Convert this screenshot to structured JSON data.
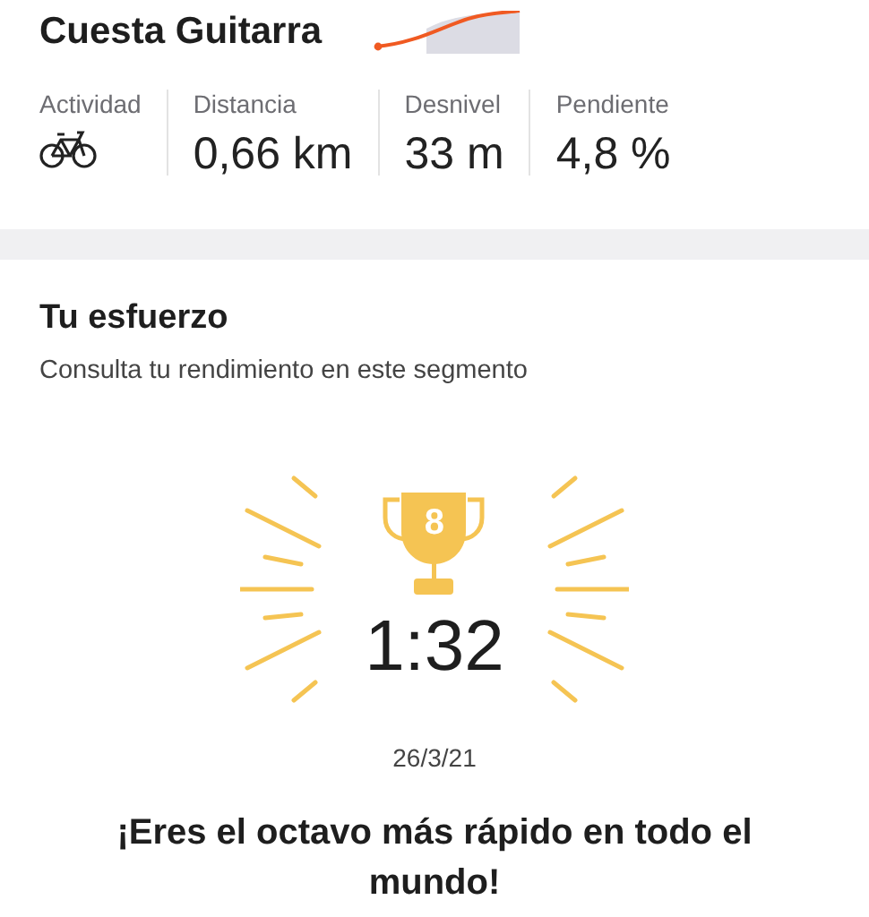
{
  "segment": {
    "title": "Cuesta Guitarra"
  },
  "stats": [
    {
      "kind": "icon",
      "label": "Actividad"
    },
    {
      "kind": "value",
      "label": "Distancia",
      "value": "0,66 km"
    },
    {
      "kind": "value",
      "label": "Desnivel",
      "value": "33 m"
    },
    {
      "kind": "value",
      "label": "Pendiente",
      "value": "4,8 %"
    }
  ],
  "effort": {
    "title": "Tu esfuerzo",
    "subtitle": "Consulta tu rendimiento en este segmento",
    "rank": "8",
    "time": "1:32",
    "date": "26/3/21",
    "message": "¡Eres el octavo más rápido en todo el mundo!"
  }
}
